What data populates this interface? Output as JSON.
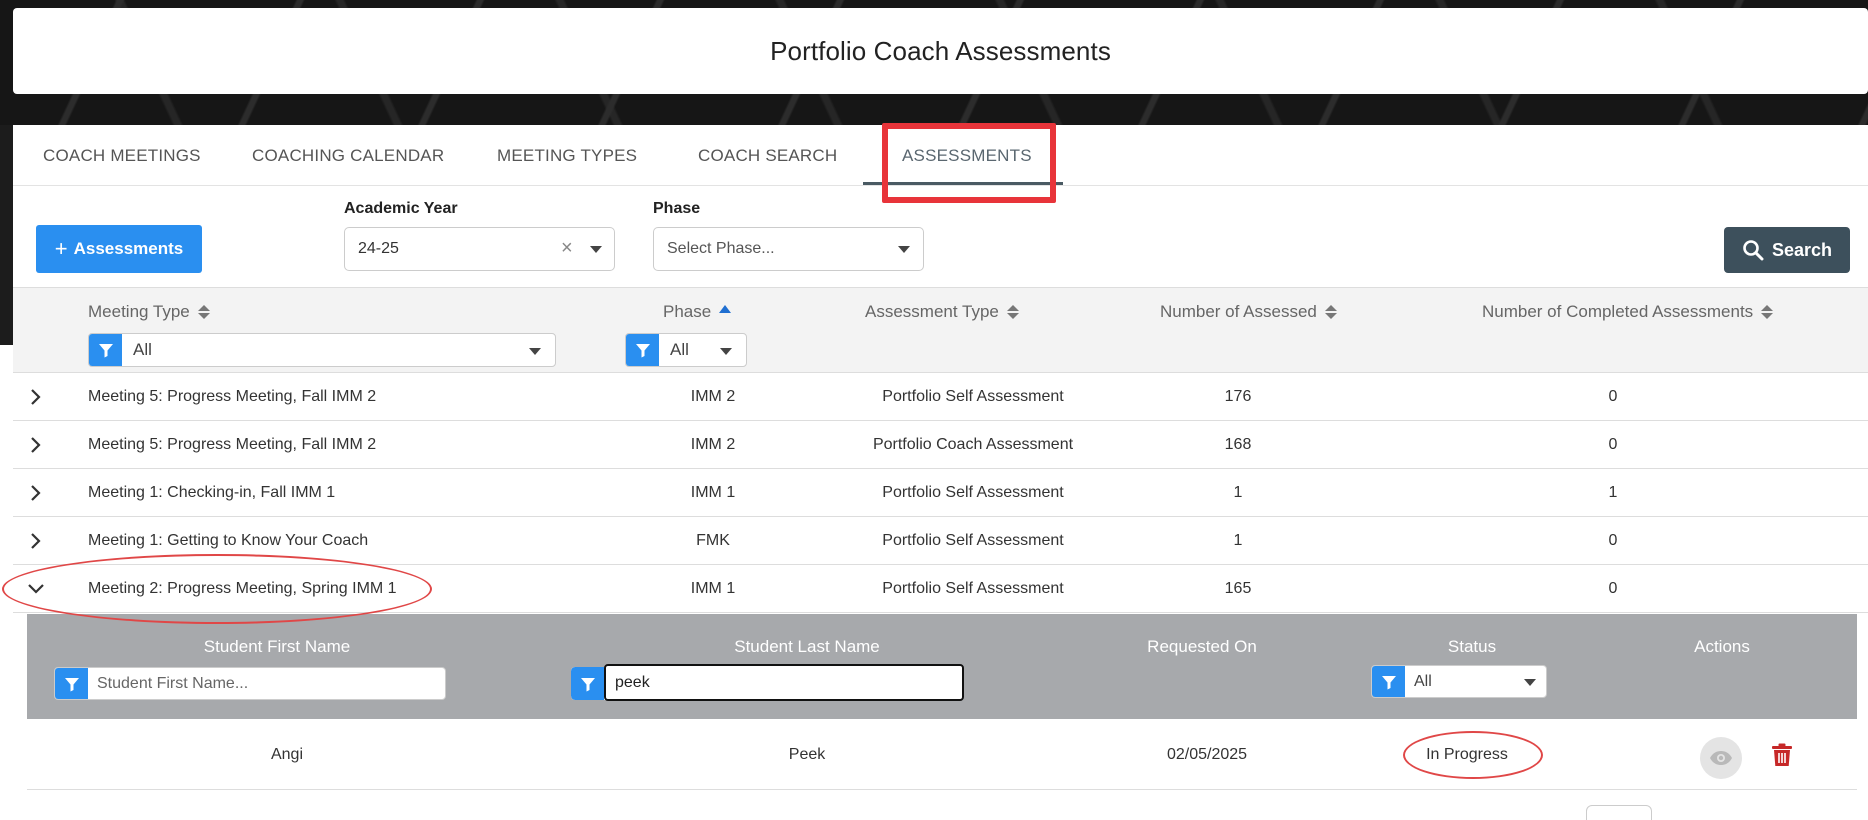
{
  "page": {
    "title": "Portfolio Coach Assessments"
  },
  "tabs": [
    {
      "label": "COACH MEETINGS"
    },
    {
      "label": "COACHING CALENDAR"
    },
    {
      "label": "MEETING TYPES"
    },
    {
      "label": "COACH SEARCH"
    },
    {
      "label": "ASSESSMENTS",
      "active": true
    }
  ],
  "toolbar": {
    "add_label": "Assessments",
    "academic_year_label": "Academic Year",
    "academic_year_value": "24-25",
    "phase_label": "Phase",
    "phase_placeholder": "Select Phase...",
    "search_label": "Search"
  },
  "grid": {
    "columns": {
      "meeting_type": "Meeting Type",
      "phase": "Phase",
      "assessment_type": "Assessment Type",
      "num_assessed": "Number of Assessed",
      "num_completed": "Number of Completed Assessments"
    },
    "filters": {
      "meeting_type": "All",
      "phase": "All"
    },
    "rows": [
      {
        "meeting_type": "Meeting 5: Progress Meeting, Fall IMM 2",
        "phase": "IMM 2",
        "assessment_type": "Portfolio Self Assessment",
        "num_assessed": "176",
        "num_completed": "0"
      },
      {
        "meeting_type": "Meeting 5: Progress Meeting, Fall IMM 2",
        "phase": "IMM 2",
        "assessment_type": "Portfolio Coach Assessment",
        "num_assessed": "168",
        "num_completed": "0"
      },
      {
        "meeting_type": "Meeting 1: Checking-in, Fall IMM 1",
        "phase": "IMM 1",
        "assessment_type": "Portfolio Self Assessment",
        "num_assessed": "1",
        "num_completed": "1"
      },
      {
        "meeting_type": "Meeting 1: Getting to Know Your Coach",
        "phase": "FMK",
        "assessment_type": "Portfolio Self Assessment",
        "num_assessed": "1",
        "num_completed": "0"
      },
      {
        "meeting_type": "Meeting 2: Progress Meeting, Spring IMM 1",
        "phase": "IMM 1",
        "assessment_type": "Portfolio Self Assessment",
        "num_assessed": "165",
        "num_completed": "0",
        "expanded": true
      }
    ]
  },
  "subgrid": {
    "columns": {
      "first_name": "Student First Name",
      "last_name": "Student Last Name",
      "requested_on": "Requested On",
      "status": "Status",
      "actions": "Actions"
    },
    "filters": {
      "first_name_placeholder": "Student First Name...",
      "last_name_value": "peek",
      "status_value": "All"
    },
    "rows": [
      {
        "first_name": "Angi",
        "last_name": "Peek",
        "requested_on": "02/05/2025",
        "status": "In Progress"
      }
    ]
  },
  "colors": {
    "primary": "#2a8ff0",
    "search_button": "#3d505c",
    "highlight": "#e8343a",
    "delete": "#c62828"
  },
  "icons": [
    "plus-icon",
    "clear-icon",
    "dropdown-icon",
    "search-icon",
    "sort-icon",
    "filter-icon",
    "chevron-right-icon",
    "chevron-down-icon",
    "eye-icon",
    "trash-icon"
  ]
}
